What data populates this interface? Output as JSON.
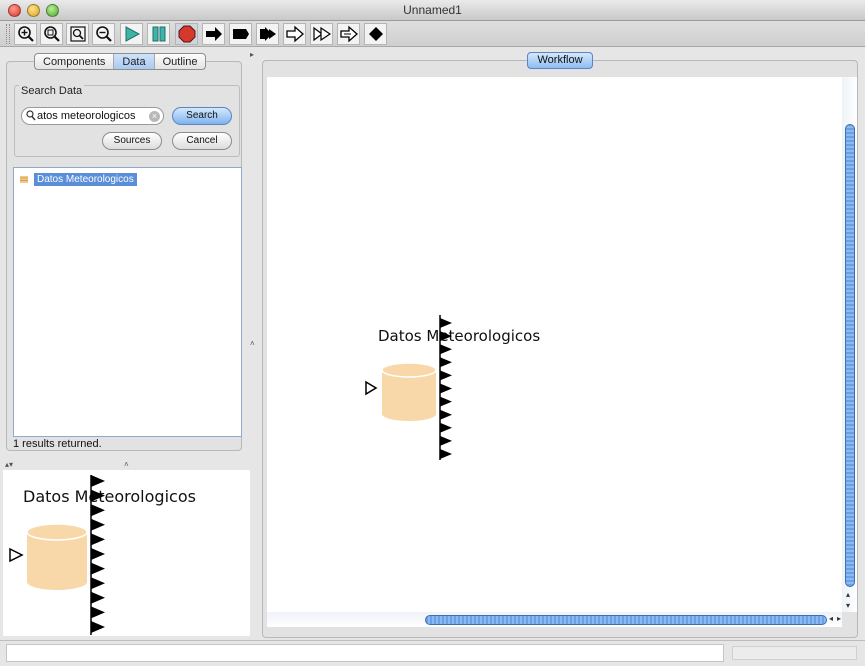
{
  "window": {
    "title": "Unnamed1"
  },
  "toolbar": {
    "buttons": [
      {
        "name": "zoom-in-icon"
      },
      {
        "name": "zoom-fit-icon"
      },
      {
        "name": "zoom-reset-icon"
      },
      {
        "name": "zoom-out-icon"
      },
      {
        "name": "run-icon"
      },
      {
        "name": "pause-icon"
      },
      {
        "name": "stop-icon"
      },
      {
        "name": "arrow-right-icon"
      },
      {
        "name": "flag-icon"
      },
      {
        "name": "double-arrow-icon"
      },
      {
        "name": "outline-arrow-icon"
      },
      {
        "name": "fast-forward-icon"
      },
      {
        "name": "outline-arrow-2-icon"
      },
      {
        "name": "diamond-icon"
      }
    ]
  },
  "left_panel": {
    "tabs": [
      {
        "label": "Components",
        "active": false
      },
      {
        "label": "Data",
        "active": true
      },
      {
        "label": "Outline",
        "active": false
      }
    ],
    "search_group_label": "Search Data",
    "search_value": "atos meteorologicos",
    "search_button": "Search",
    "sources_button": "Sources",
    "cancel_button": "Cancel",
    "results": [
      {
        "label": "Datos Meteorologicos"
      }
    ],
    "status": "1 results returned."
  },
  "workflow": {
    "tab_label": "Workflow",
    "node": {
      "label": "Datos Meteorologicos",
      "output_ports": 11,
      "color": "#f8d8a8"
    }
  },
  "preview": {
    "node_label": "Datos Meteorologicos"
  },
  "colors": {
    "accent": "#5b8ed8",
    "actor_fill": "#f8d8a8",
    "scroll_thumb": "#6aa0e6"
  }
}
